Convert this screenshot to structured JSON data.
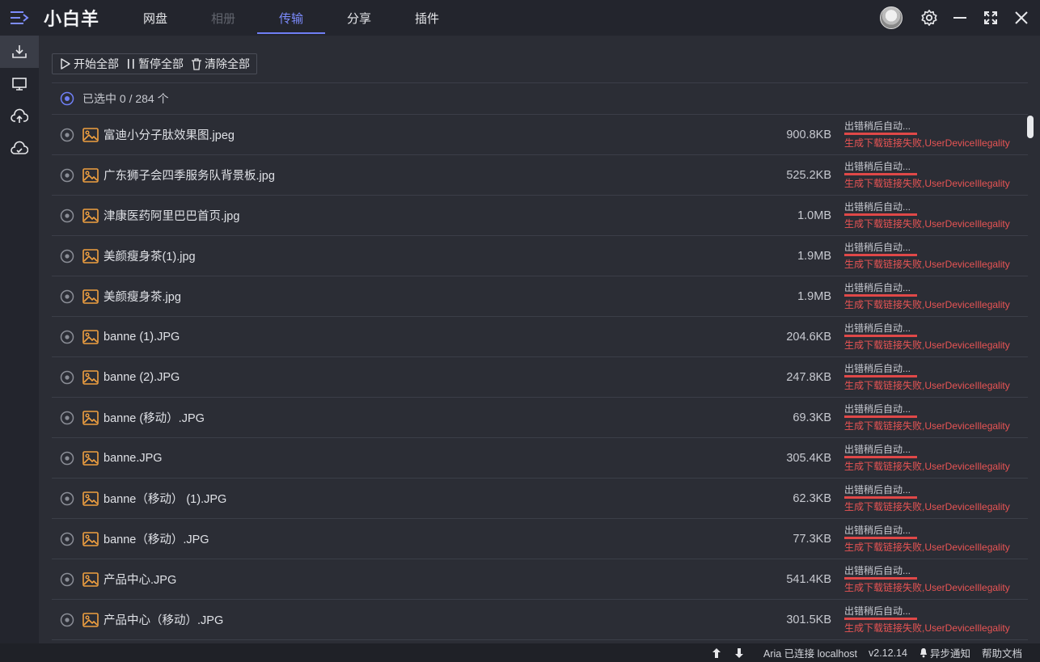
{
  "app": {
    "title": "小白羊"
  },
  "nav": {
    "tabs": [
      {
        "label": "网盘",
        "state": "normal"
      },
      {
        "label": "相册",
        "state": "disabled"
      },
      {
        "label": "传输",
        "state": "active"
      },
      {
        "label": "分享",
        "state": "normal"
      },
      {
        "label": "插件",
        "state": "normal"
      }
    ]
  },
  "sidebar": {
    "items": [
      {
        "icon": "download-icon",
        "active": true
      },
      {
        "icon": "monitor-icon",
        "active": false
      },
      {
        "icon": "cloud-upload-icon",
        "active": false
      },
      {
        "icon": "cloud-check-icon",
        "active": false
      }
    ]
  },
  "toolbar": {
    "start_all": "开始全部",
    "pause_all": "暂停全部",
    "clear_all": "清除全部"
  },
  "selection": {
    "text": "已选中 0 / 284 个"
  },
  "files": [
    {
      "name": "富迪小分子肽效果图.jpeg",
      "size": "900.8KB"
    },
    {
      "name": "广东狮子会四季服务队背景板.jpg",
      "size": "525.2KB"
    },
    {
      "name": "津康医药阿里巴巴首页.jpg",
      "size": "1.0MB"
    },
    {
      "name": "美颜瘦身茶(1).jpg",
      "size": "1.9MB"
    },
    {
      "name": "美颜瘦身茶.jpg",
      "size": "1.9MB"
    },
    {
      "name": "banne (1).JPG",
      "size": "204.6KB"
    },
    {
      "name": "banne (2).JPG",
      "size": "247.8KB"
    },
    {
      "name": "banne (移动）.JPG",
      "size": "69.3KB"
    },
    {
      "name": "banne.JPG",
      "size": "305.4KB"
    },
    {
      "name": "banne（移动） (1).JPG",
      "size": "62.3KB"
    },
    {
      "name": "banne（移动）.JPG",
      "size": "77.3KB"
    },
    {
      "name": "产品中心.JPG",
      "size": "541.4KB"
    },
    {
      "name": "产品中心（移动）.JPG",
      "size": "301.5KB"
    }
  ],
  "row_status": {
    "line1": "出错稍后自动...",
    "line2": "生成下载链接失败,UserDeviceIllegality"
  },
  "statusbar": {
    "aria": "Aria 已连接 localhost",
    "version": "v2.12.14",
    "notify": "异步通知",
    "help": "帮助文档"
  },
  "colors": {
    "accent": "#6f7ff5",
    "error": "#e85454",
    "file_icon": "#f0a040"
  }
}
